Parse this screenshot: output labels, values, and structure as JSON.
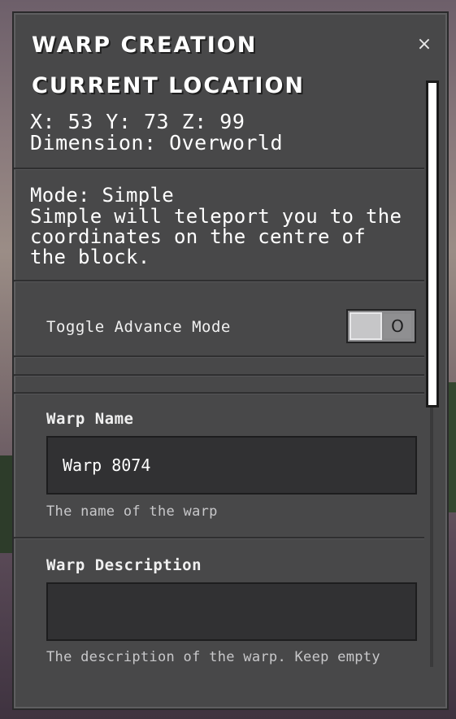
{
  "dialog": {
    "title": "Warp Creation",
    "close_label": "×"
  },
  "location": {
    "heading": "Current Location",
    "coords_line": "X: 53 Y: 73 Z: 99",
    "dimension_line": "Dimension: Overworld"
  },
  "mode": {
    "line1": "Mode: Simple",
    "description": "Simple will teleport you to the coordinates on the centre of the block."
  },
  "toggle": {
    "label": "Toggle Advance Mode",
    "state_glyph": "O",
    "enabled": false
  },
  "warp_name": {
    "label": "Warp Name",
    "value": "Warp 8074",
    "help": "The name of the warp"
  },
  "warp_description": {
    "label": "Warp Description",
    "value": "",
    "help": "The description of the warp. Keep empty"
  }
}
